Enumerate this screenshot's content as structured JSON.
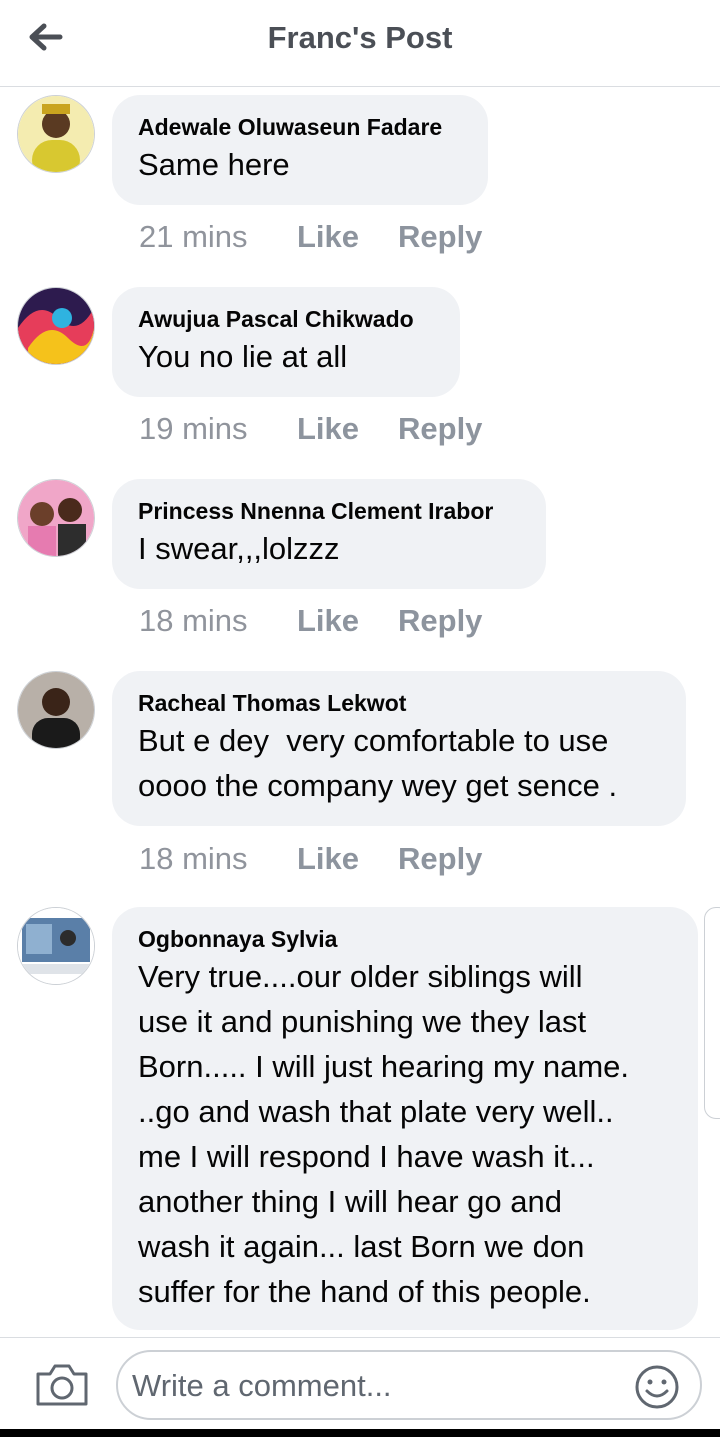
{
  "header": {
    "title": "Franc's Post",
    "back_icon": "arrow-left-icon"
  },
  "comments": [
    {
      "author": "Adewale Oluwaseun Fadare",
      "text": "Same here",
      "time": "21 mins",
      "like": "Like",
      "reply": "Reply"
    },
    {
      "author": "Awujua Pascal Chikwado",
      "text": "You no lie at all",
      "time": "19 mins",
      "like": "Like",
      "reply": "Reply"
    },
    {
      "author": "Princess Nnenna Clement Irabor",
      "text": "I swear,,,lolzzz",
      "time": "18 mins",
      "like": "Like",
      "reply": "Reply"
    },
    {
      "author": "Racheal Thomas Lekwot",
      "text": "But e dey  very comfortable to use\noooo the company wey get sence .",
      "time": "18 mins",
      "like": "Like",
      "reply": "Reply"
    },
    {
      "author": "Ogbonnaya Sylvia",
      "text": "Very true....our older siblings will\nuse it and punishing we they last\nBorn..... I will just hearing my name.\n..go and wash that plate very well..\nme I will respond I have wash it...\nanother thing I will hear go and\nwash it again... last Born we don\nsuffer for the hand of this people."
    }
  ],
  "composer": {
    "placeholder": "Write a comment...",
    "camera_icon": "camera-icon",
    "emoji_icon": "smiley-icon"
  },
  "colors": {
    "bubble": "#f0f2f5",
    "meta": "#90949c",
    "border": "#dadde1"
  }
}
